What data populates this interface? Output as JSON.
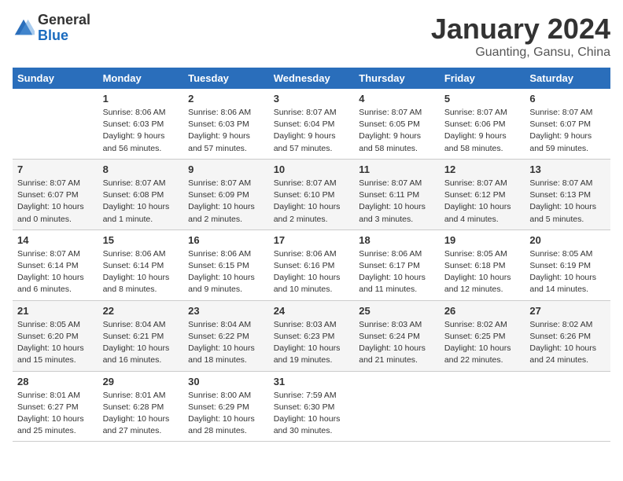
{
  "logo": {
    "general": "General",
    "blue": "Blue"
  },
  "title": "January 2024",
  "location": "Guanting, Gansu, China",
  "days_of_week": [
    "Sunday",
    "Monday",
    "Tuesday",
    "Wednesday",
    "Thursday",
    "Friday",
    "Saturday"
  ],
  "weeks": [
    [
      {
        "day": "",
        "info": []
      },
      {
        "day": "1",
        "info": [
          "Sunrise: 8:06 AM",
          "Sunset: 6:03 PM",
          "Daylight: 9 hours",
          "and 56 minutes."
        ]
      },
      {
        "day": "2",
        "info": [
          "Sunrise: 8:06 AM",
          "Sunset: 6:03 PM",
          "Daylight: 9 hours",
          "and 57 minutes."
        ]
      },
      {
        "day": "3",
        "info": [
          "Sunrise: 8:07 AM",
          "Sunset: 6:04 PM",
          "Daylight: 9 hours",
          "and 57 minutes."
        ]
      },
      {
        "day": "4",
        "info": [
          "Sunrise: 8:07 AM",
          "Sunset: 6:05 PM",
          "Daylight: 9 hours",
          "and 58 minutes."
        ]
      },
      {
        "day": "5",
        "info": [
          "Sunrise: 8:07 AM",
          "Sunset: 6:06 PM",
          "Daylight: 9 hours",
          "and 58 minutes."
        ]
      },
      {
        "day": "6",
        "info": [
          "Sunrise: 8:07 AM",
          "Sunset: 6:07 PM",
          "Daylight: 9 hours",
          "and 59 minutes."
        ]
      }
    ],
    [
      {
        "day": "7",
        "info": [
          "Sunrise: 8:07 AM",
          "Sunset: 6:07 PM",
          "Daylight: 10 hours",
          "and 0 minutes."
        ]
      },
      {
        "day": "8",
        "info": [
          "Sunrise: 8:07 AM",
          "Sunset: 6:08 PM",
          "Daylight: 10 hours",
          "and 1 minute."
        ]
      },
      {
        "day": "9",
        "info": [
          "Sunrise: 8:07 AM",
          "Sunset: 6:09 PM",
          "Daylight: 10 hours",
          "and 2 minutes."
        ]
      },
      {
        "day": "10",
        "info": [
          "Sunrise: 8:07 AM",
          "Sunset: 6:10 PM",
          "Daylight: 10 hours",
          "and 2 minutes."
        ]
      },
      {
        "day": "11",
        "info": [
          "Sunrise: 8:07 AM",
          "Sunset: 6:11 PM",
          "Daylight: 10 hours",
          "and 3 minutes."
        ]
      },
      {
        "day": "12",
        "info": [
          "Sunrise: 8:07 AM",
          "Sunset: 6:12 PM",
          "Daylight: 10 hours",
          "and 4 minutes."
        ]
      },
      {
        "day": "13",
        "info": [
          "Sunrise: 8:07 AM",
          "Sunset: 6:13 PM",
          "Daylight: 10 hours",
          "and 5 minutes."
        ]
      }
    ],
    [
      {
        "day": "14",
        "info": [
          "Sunrise: 8:07 AM",
          "Sunset: 6:14 PM",
          "Daylight: 10 hours",
          "and 6 minutes."
        ]
      },
      {
        "day": "15",
        "info": [
          "Sunrise: 8:06 AM",
          "Sunset: 6:14 PM",
          "Daylight: 10 hours",
          "and 8 minutes."
        ]
      },
      {
        "day": "16",
        "info": [
          "Sunrise: 8:06 AM",
          "Sunset: 6:15 PM",
          "Daylight: 10 hours",
          "and 9 minutes."
        ]
      },
      {
        "day": "17",
        "info": [
          "Sunrise: 8:06 AM",
          "Sunset: 6:16 PM",
          "Daylight: 10 hours",
          "and 10 minutes."
        ]
      },
      {
        "day": "18",
        "info": [
          "Sunrise: 8:06 AM",
          "Sunset: 6:17 PM",
          "Daylight: 10 hours",
          "and 11 minutes."
        ]
      },
      {
        "day": "19",
        "info": [
          "Sunrise: 8:05 AM",
          "Sunset: 6:18 PM",
          "Daylight: 10 hours",
          "and 12 minutes."
        ]
      },
      {
        "day": "20",
        "info": [
          "Sunrise: 8:05 AM",
          "Sunset: 6:19 PM",
          "Daylight: 10 hours",
          "and 14 minutes."
        ]
      }
    ],
    [
      {
        "day": "21",
        "info": [
          "Sunrise: 8:05 AM",
          "Sunset: 6:20 PM",
          "Daylight: 10 hours",
          "and 15 minutes."
        ]
      },
      {
        "day": "22",
        "info": [
          "Sunrise: 8:04 AM",
          "Sunset: 6:21 PM",
          "Daylight: 10 hours",
          "and 16 minutes."
        ]
      },
      {
        "day": "23",
        "info": [
          "Sunrise: 8:04 AM",
          "Sunset: 6:22 PM",
          "Daylight: 10 hours",
          "and 18 minutes."
        ]
      },
      {
        "day": "24",
        "info": [
          "Sunrise: 8:03 AM",
          "Sunset: 6:23 PM",
          "Daylight: 10 hours",
          "and 19 minutes."
        ]
      },
      {
        "day": "25",
        "info": [
          "Sunrise: 8:03 AM",
          "Sunset: 6:24 PM",
          "Daylight: 10 hours",
          "and 21 minutes."
        ]
      },
      {
        "day": "26",
        "info": [
          "Sunrise: 8:02 AM",
          "Sunset: 6:25 PM",
          "Daylight: 10 hours",
          "and 22 minutes."
        ]
      },
      {
        "day": "27",
        "info": [
          "Sunrise: 8:02 AM",
          "Sunset: 6:26 PM",
          "Daylight: 10 hours",
          "and 24 minutes."
        ]
      }
    ],
    [
      {
        "day": "28",
        "info": [
          "Sunrise: 8:01 AM",
          "Sunset: 6:27 PM",
          "Daylight: 10 hours",
          "and 25 minutes."
        ]
      },
      {
        "day": "29",
        "info": [
          "Sunrise: 8:01 AM",
          "Sunset: 6:28 PM",
          "Daylight: 10 hours",
          "and 27 minutes."
        ]
      },
      {
        "day": "30",
        "info": [
          "Sunrise: 8:00 AM",
          "Sunset: 6:29 PM",
          "Daylight: 10 hours",
          "and 28 minutes."
        ]
      },
      {
        "day": "31",
        "info": [
          "Sunrise: 7:59 AM",
          "Sunset: 6:30 PM",
          "Daylight: 10 hours",
          "and 30 minutes."
        ]
      },
      {
        "day": "",
        "info": []
      },
      {
        "day": "",
        "info": []
      },
      {
        "day": "",
        "info": []
      }
    ]
  ]
}
